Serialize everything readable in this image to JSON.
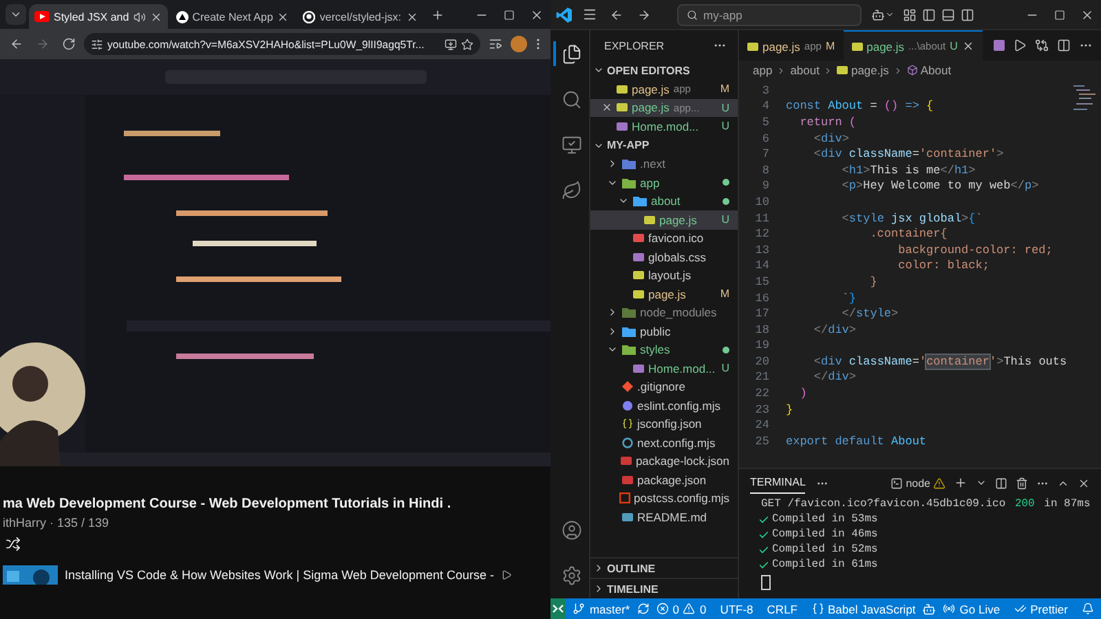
{
  "browser": {
    "tabs": [
      {
        "kind": "youtube",
        "title": "Styled JSX and",
        "audio": true,
        "selected": true
      },
      {
        "kind": "nextjs",
        "title": "Create Next App",
        "audio": false,
        "selected": false
      },
      {
        "kind": "github",
        "title": "vercel/styled-jsx:",
        "audio": false,
        "selected": false
      }
    ],
    "address": "youtube.com/watch?v=M6aXSV2HAHo&list=PLu0W_9lII9agq5Tr..."
  },
  "playlist": {
    "title": "ma Web Development Course - Web Development Tutorials in Hindi .",
    "channel": "ithHarry",
    "position": "· 135 / 139",
    "next_video": "Installing VS Code & How Websites Work | Sigma Web Development Course -"
  },
  "vscode": {
    "search": "my-app",
    "explorer": "EXPLORER",
    "open_editors": {
      "title": "OPEN EDITORS",
      "items": [
        {
          "kind": "js",
          "name": "page.js",
          "detail": "app",
          "badge": "M",
          "color": "#e2c08d",
          "selected": false
        },
        {
          "kind": "js",
          "name": "page.js",
          "detail": "app...",
          "badge": "U",
          "color": "#73c991",
          "selected": true
        },
        {
          "kind": "css",
          "name": "Home.mod...",
          "badge": "U",
          "color": "#73c991",
          "selected": false
        }
      ]
    },
    "workspace": {
      "title": "MY-APP",
      "tree": [
        {
          "kind": "folder-next",
          "name": ".next",
          "color": "#8c8c8c",
          "dot": false,
          "expanded": false,
          "selected": false
        },
        {
          "kind": "folder-app",
          "name": "app",
          "color": "#73c991",
          "dot": true,
          "expanded": true,
          "selected": false,
          "children": [
            {
              "kind": "folder",
              "name": "about",
              "color": "#73c991",
              "dot": true,
              "expanded": true,
              "selected": false,
              "children": [
                {
                  "kind": "js",
                  "name": "page.js",
                  "badge": "U",
                  "color": "#73c991",
                  "selected": true
                }
              ]
            },
            {
              "kind": "ico",
              "name": "favicon.ico",
              "color": "#cccccc",
              "selected": false
            },
            {
              "kind": "css",
              "name": "globals.css",
              "color": "#cccccc",
              "selected": false
            },
            {
              "kind": "js",
              "name": "layout.js",
              "color": "#cccccc",
              "selected": false
            },
            {
              "kind": "js",
              "name": "page.js",
              "badge": "M",
              "color": "#e2c08d",
              "selected": false
            }
          ]
        },
        {
          "kind": "folder-node",
          "name": "node_modules",
          "color": "#8c8c8c",
          "dot": false,
          "expanded": false,
          "selected": false
        },
        {
          "kind": "folder-public",
          "name": "public",
          "color": "#cccccc",
          "dot": false,
          "expanded": false,
          "selected": false
        },
        {
          "kind": "folder-styles",
          "name": "styles",
          "color": "#73c991",
          "dot": true,
          "expanded": true,
          "selected": false,
          "children": [
            {
              "kind": "css",
              "name": "Home.mod...",
              "badge": "U",
              "color": "#73c991",
              "selected": false
            }
          ]
        },
        {
          "kind": "git",
          "name": ".gitignore",
          "color": "#cccccc",
          "selected": false
        },
        {
          "kind": "eslint",
          "name": "eslint.config.mjs",
          "color": "#cccccc",
          "selected": false
        },
        {
          "kind": "json",
          "name": "jsconfig.json",
          "color": "#cccccc",
          "selected": false
        },
        {
          "kind": "next",
          "name": "next.config.mjs",
          "color": "#cccccc",
          "selected": false
        },
        {
          "kind": "npm",
          "name": "package-lock.json",
          "color": "#cccccc",
          "selected": false
        },
        {
          "kind": "npm",
          "name": "package.json",
          "color": "#cccccc",
          "selected": false
        },
        {
          "kind": "postcss",
          "name": "postcss.config.mjs",
          "color": "#cccccc",
          "selected": false
        },
        {
          "kind": "readme",
          "name": "README.md",
          "color": "#cccccc",
          "selected": false
        }
      ]
    },
    "panels": [
      {
        "title": "OUTLINE",
        "expanded": false
      },
      {
        "title": "TIMELINE",
        "expanded": false
      }
    ],
    "editor": {
      "tabs": [
        {
          "kind": "js",
          "name": "page.js",
          "detail": "app",
          "badge": "M",
          "color": "#e2c08d",
          "selected": false
        },
        {
          "kind": "js",
          "name": "page.js",
          "detail": "...\\about",
          "badge": "U",
          "color": "#73c991",
          "selected": true
        }
      ],
      "breadcrumbs": [
        {
          "kind": "folder",
          "text": "app"
        },
        {
          "kind": "folder",
          "text": "about"
        },
        {
          "kind": "js",
          "text": "page.js"
        },
        {
          "kind": "symbol",
          "text": "About"
        }
      ],
      "lines": [
        {
          "number": "3"
        },
        {
          "number": "4",
          "tokens": [
            {
              "kind": "kw",
              "text": "const "
            },
            {
              "kind": "var",
              "text": "About "
            },
            {
              "kind": "op",
              "text": "= "
            },
            {
              "kind": "paren",
              "text": "() "
            },
            {
              "kind": "kw",
              "text": "=> "
            },
            {
              "kind": "brace",
              "text": "{"
            }
          ]
        },
        {
          "number": "5",
          "tokens": [
            {
              "kind": "ctrl",
              "text": "  return "
            },
            {
              "kind": "paren",
              "text": "("
            }
          ]
        },
        {
          "number": "6",
          "tokens": [
            {
              "kind": "punct",
              "text": "    <"
            },
            {
              "kind": "tag",
              "text": "div"
            },
            {
              "kind": "punct",
              "text": ">"
            }
          ]
        },
        {
          "number": "7",
          "tokens": [
            {
              "kind": "punct",
              "text": "    <"
            },
            {
              "kind": "tag",
              "text": "div "
            },
            {
              "kind": "attr",
              "text": "className"
            },
            {
              "kind": "op",
              "text": "="
            },
            {
              "kind": "str",
              "text": "'container'"
            },
            {
              "kind": "punct",
              "text": ">"
            }
          ]
        },
        {
          "number": "8",
          "tokens": [
            {
              "kind": "punct",
              "text": "        <"
            },
            {
              "kind": "tag",
              "text": "h1"
            },
            {
              "kind": "punct",
              "text": ">"
            },
            {
              "kind": "text",
              "text": "This is me"
            },
            {
              "kind": "punct",
              "text": "</"
            },
            {
              "kind": "tag",
              "text": "h1"
            },
            {
              "kind": "punct",
              "text": ">"
            }
          ]
        },
        {
          "number": "9",
          "tokens": [
            {
              "kind": "punct",
              "text": "        <"
            },
            {
              "kind": "tag",
              "text": "p"
            },
            {
              "kind": "punct",
              "text": ">"
            },
            {
              "kind": "text",
              "text": "Hey Welcome to my web"
            },
            {
              "kind": "punct",
              "text": "</"
            },
            {
              "kind": "tag",
              "text": "p"
            },
            {
              "kind": "punct",
              "text": ">"
            }
          ]
        },
        {
          "number": "10"
        },
        {
          "number": "11",
          "tokens": [
            {
              "kind": "punct",
              "text": "        <"
            },
            {
              "kind": "tag",
              "text": "style "
            },
            {
              "kind": "attr",
              "text": "jsx global"
            },
            {
              "kind": "punct",
              "text": ">"
            },
            {
              "kind": "brace2",
              "text": "{"
            },
            {
              "kind": "str",
              "text": "`"
            }
          ]
        },
        {
          "number": "12",
          "tokens": [
            {
              "kind": "str",
              "text": "            .container{"
            }
          ]
        },
        {
          "number": "13",
          "tokens": [
            {
              "kind": "str",
              "text": "                background-color: red;"
            }
          ]
        },
        {
          "number": "14",
          "tokens": [
            {
              "kind": "str",
              "text": "                color: black;"
            }
          ]
        },
        {
          "number": "15",
          "tokens": [
            {
              "kind": "str",
              "text": "            }"
            }
          ]
        },
        {
          "number": "16",
          "tokens": [
            {
              "kind": "str",
              "text": "        `"
            },
            {
              "kind": "brace2",
              "text": "}"
            }
          ]
        },
        {
          "number": "17",
          "tokens": [
            {
              "kind": "punct",
              "text": "        </"
            },
            {
              "kind": "tag",
              "text": "style"
            },
            {
              "kind": "punct",
              "text": ">"
            }
          ]
        },
        {
          "number": "18",
          "tokens": [
            {
              "kind": "punct",
              "text": "    </"
            },
            {
              "kind": "tag",
              "text": "div"
            },
            {
              "kind": "punct",
              "text": ">"
            }
          ]
        },
        {
          "number": "19"
        },
        {
          "number": "20",
          "tokens": [
            {
              "kind": "punct",
              "text": "    <"
            },
            {
              "kind": "tag",
              "text": "div "
            },
            {
              "kind": "attr",
              "text": "className"
            },
            {
              "kind": "op",
              "text": "="
            },
            {
              "kind": "str",
              "text": "'"
            },
            {
              "kind": "match",
              "text": "container"
            },
            {
              "kind": "str",
              "text": "'"
            },
            {
              "kind": "punct",
              "text": ">"
            },
            {
              "kind": "text",
              "text": "This outs"
            }
          ]
        },
        {
          "number": "21",
          "tokens": [
            {
              "kind": "punct",
              "text": "    </"
            },
            {
              "kind": "tag",
              "text": "div"
            },
            {
              "kind": "punct",
              "text": ">"
            }
          ]
        },
        {
          "number": "22",
          "tokens": [
            {
              "kind": "paren",
              "text": "  )"
            }
          ]
        },
        {
          "number": "23",
          "tokens": [
            {
              "kind": "brace",
              "text": "}"
            }
          ]
        },
        {
          "number": "24"
        },
        {
          "number": "25",
          "tokens": [
            {
              "kind": "kw",
              "text": "export default "
            },
            {
              "kind": "var",
              "text": "About"
            }
          ]
        }
      ]
    },
    "terminal": {
      "title": "TERMINAL",
      "shell": "node",
      "lines": [
        {
          "kind": "request",
          "text": "GET /favicon.ico?favicon.45db1c09.ico ",
          "status": "200",
          "suffix": " in 87ms"
        },
        {
          "kind": "success",
          "text": "Compiled in 53ms"
        },
        {
          "kind": "success",
          "text": "Compiled in 46ms"
        },
        {
          "kind": "success",
          "text": "Compiled in 52ms"
        },
        {
          "kind": "success",
          "text": "Compiled in 61ms"
        }
      ]
    },
    "status_bar": {
      "branch": "master*",
      "errors": "0",
      "warnings": "0",
      "encoding": "UTF-8",
      "eol": "CRLF",
      "language": "Babel JavaScript",
      "live": "Go Live",
      "formatter": "Prettier"
    }
  }
}
